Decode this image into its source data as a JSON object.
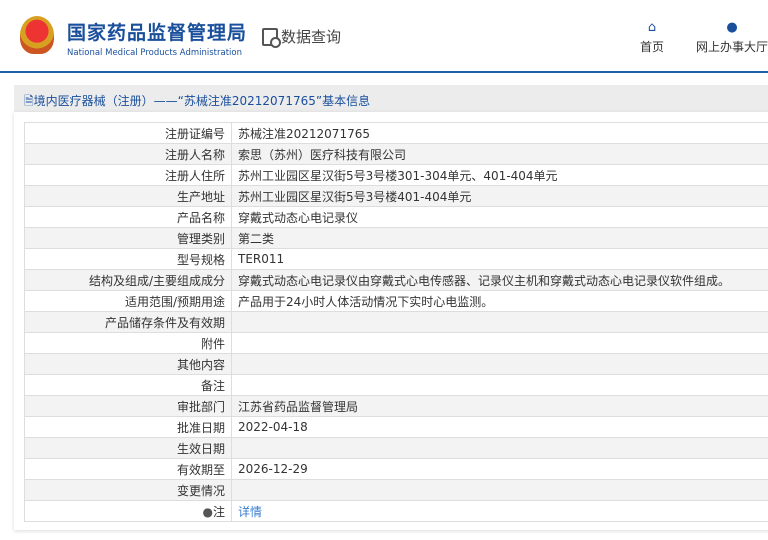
{
  "header": {
    "title_cn": "国家药品监督管理局",
    "title_en": "National Medical Products Administration",
    "section": "数据查询",
    "nav": [
      {
        "label": "首页",
        "icon": "home-icon"
      },
      {
        "label": "网上办事大厅",
        "icon": "user-icon"
      }
    ]
  },
  "breadcrumb": "境内医疗器械（注册）——“苏械注准20212071765”基本信息",
  "rows": [
    {
      "label": "注册证编号",
      "value": "苏械注准20212071765"
    },
    {
      "label": "注册人名称",
      "value": "索思（苏州）医疗科技有限公司"
    },
    {
      "label": "注册人住所",
      "value": "苏州工业园区星汉街5号3号楼301-304单元、401-404单元"
    },
    {
      "label": "生产地址",
      "value": "苏州工业园区星汉街5号3号楼401-404单元"
    },
    {
      "label": "产品名称",
      "value": "穿戴式动态心电记录仪"
    },
    {
      "label": "管理类别",
      "value": "第二类"
    },
    {
      "label": "型号规格",
      "value": "TER011"
    },
    {
      "label": "结构及组成/主要组成成分",
      "value": "穿戴式动态心电记录仪由穿戴式心电传感器、记录仪主机和穿戴式动态心电记录仪软件组成。"
    },
    {
      "label": "适用范围/预期用途",
      "value": "产品用于24小时人体活动情况下实时心电监测。"
    },
    {
      "label": "产品储存条件及有效期",
      "value": ""
    },
    {
      "label": "附件",
      "value": ""
    },
    {
      "label": "其他内容",
      "value": ""
    },
    {
      "label": "备注",
      "value": ""
    },
    {
      "label": "审批部门",
      "value": "江苏省药品监督管理局"
    },
    {
      "label": "批准日期",
      "value": "2022-04-18"
    },
    {
      "label": "生效日期",
      "value": ""
    },
    {
      "label": "有效期至",
      "value": "2026-12-29"
    },
    {
      "label": "变更情况",
      "value": ""
    }
  ],
  "note": {
    "label": "注",
    "link": "详情"
  }
}
